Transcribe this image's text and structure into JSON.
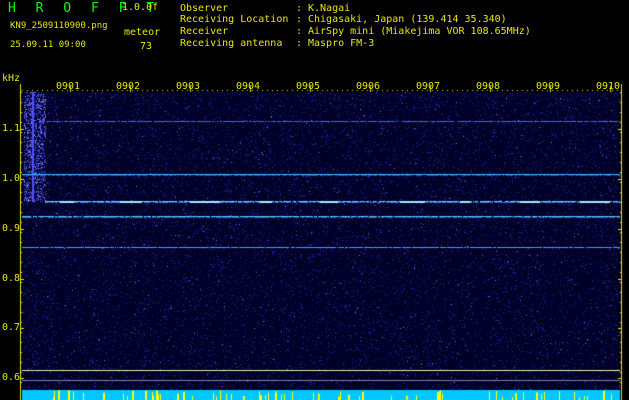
{
  "header": {
    "brand": "H R O F F T",
    "version": "1.0.0f",
    "filename": "KN9_2509110900.png",
    "mode": "meteor",
    "timestamp": "25.09.11 09:00",
    "count": "73"
  },
  "info": [
    {
      "label": "Observer",
      "value": "K.Nagai"
    },
    {
      "label": "Receiving Location",
      "value": "Chigasaki, Japan (139.414 35.340)"
    },
    {
      "label": "Receiver",
      "value": "AirSpy mini (Miakejima VOR 108.65MHz)"
    },
    {
      "label": "Receiving antenna",
      "value": "Maspro FM-3"
    }
  ],
  "colon": ":",
  "axis": {
    "unit": "kHz",
    "y_ticks": [
      "1.1",
      "1.0",
      "0.9",
      "0.8",
      "0.7",
      "0.6"
    ],
    "x_ticks": [
      "0901",
      "0902",
      "0903",
      "0904",
      "0905",
      "0906",
      "0907",
      "0908",
      "0909",
      "0910"
    ]
  },
  "colors": {
    "background": "#000000",
    "label": "#e8e800",
    "brand": "#00ff00",
    "noise": "#2020c0",
    "trace": "#60d0ff",
    "reference_line": "#e8e8a0",
    "bottom_band": "#00c8ff",
    "meteor_marks": "#ffff00"
  }
}
